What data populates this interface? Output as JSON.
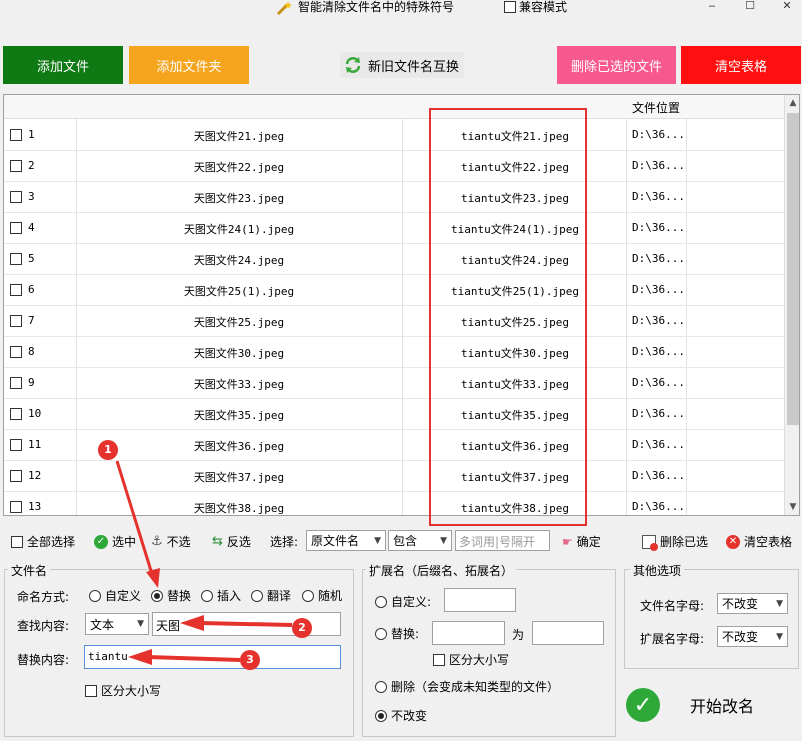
{
  "title": "智能清除文件名中的特殊符号",
  "compat_mode": "兼容模式",
  "window_buttons": [
    "‒",
    "☐",
    "✕"
  ],
  "top_buttons": {
    "add_file": "添加文件",
    "add_folder": "添加文件夹",
    "swap": "新旧文件名互换",
    "delete_selected": "删除已选的文件",
    "clear_table": "清空表格"
  },
  "colors": {
    "add_file": "#0f7a14",
    "add_folder": "#f4a41d",
    "delete_selected": "#f7598f",
    "clear_table": "#ff0f0f",
    "annotation": "#e5322d"
  },
  "table": {
    "location_header": "文件位置",
    "rows": [
      {
        "num": "1",
        "orig": "天图文件21.jpeg",
        "new": "tiantu文件21.jpeg",
        "loc": "D:\\36..."
      },
      {
        "num": "2",
        "orig": "天图文件22.jpeg",
        "new": "tiantu文件22.jpeg",
        "loc": "D:\\36..."
      },
      {
        "num": "3",
        "orig": "天图文件23.jpeg",
        "new": "tiantu文件23.jpeg",
        "loc": "D:\\36..."
      },
      {
        "num": "4",
        "orig": "天图文件24(1).jpeg",
        "new": "tiantu文件24(1).jpeg",
        "loc": "D:\\36..."
      },
      {
        "num": "5",
        "orig": "天图文件24.jpeg",
        "new": "tiantu文件24.jpeg",
        "loc": "D:\\36..."
      },
      {
        "num": "6",
        "orig": "天图文件25(1).jpeg",
        "new": "tiantu文件25(1).jpeg",
        "loc": "D:\\36..."
      },
      {
        "num": "7",
        "orig": "天图文件25.jpeg",
        "new": "tiantu文件25.jpeg",
        "loc": "D:\\36..."
      },
      {
        "num": "8",
        "orig": "天图文件30.jpeg",
        "new": "tiantu文件30.jpeg",
        "loc": "D:\\36..."
      },
      {
        "num": "9",
        "orig": "天图文件33.jpeg",
        "new": "tiantu文件33.jpeg",
        "loc": "D:\\36..."
      },
      {
        "num": "10",
        "orig": "天图文件35.jpeg",
        "new": "tiantu文件35.jpeg",
        "loc": "D:\\36..."
      },
      {
        "num": "11",
        "orig": "天图文件36.jpeg",
        "new": "tiantu文件36.jpeg",
        "loc": "D:\\36..."
      },
      {
        "num": "12",
        "orig": "天图文件37.jpeg",
        "new": "tiantu文件37.jpeg",
        "loc": "D:\\36..."
      },
      {
        "num": "13",
        "orig": "天图文件38.jpeg",
        "new": "tiantu文件38.jpeg",
        "loc": "D:\\36..."
      }
    ]
  },
  "toolbar": {
    "select_all": "全部选择",
    "select": "选中",
    "unselect": "不选",
    "invert": "反选",
    "choose_label": "选择:",
    "field_select": "原文件名",
    "match_select": "包含",
    "keyword_placeholder": "多词用|号隔开",
    "confirm": "确定",
    "delete_selected": "删除已选",
    "clear_table": "清空表格"
  },
  "filename_group": {
    "title": "文件名",
    "naming_label": "命名方式:",
    "modes": [
      "自定义",
      "替换",
      "插入",
      "翻译",
      "随机"
    ],
    "find_label": "查找内容:",
    "find_type": "文本",
    "find_value": "天图",
    "replace_label": "替换内容:",
    "replace_value": "tiantu",
    "case_label": "区分大小写"
  },
  "ext_group": {
    "title": "扩展名（后缀名、拓展名）",
    "custom_label": "自定义:",
    "replace_label": "替换:",
    "to_label": "为",
    "case_label": "区分大小写",
    "delete_label": "删除（会变成未知类型的文件）",
    "nochange_label": "不改变"
  },
  "other_group": {
    "title": "其他选项",
    "filename_case_label": "文件名字母:",
    "filename_case_value": "不改变",
    "ext_case_label": "扩展名字母:",
    "ext_case_value": "不改变"
  },
  "start_label": "开始改名",
  "annotations": [
    "1",
    "2",
    "3"
  ]
}
